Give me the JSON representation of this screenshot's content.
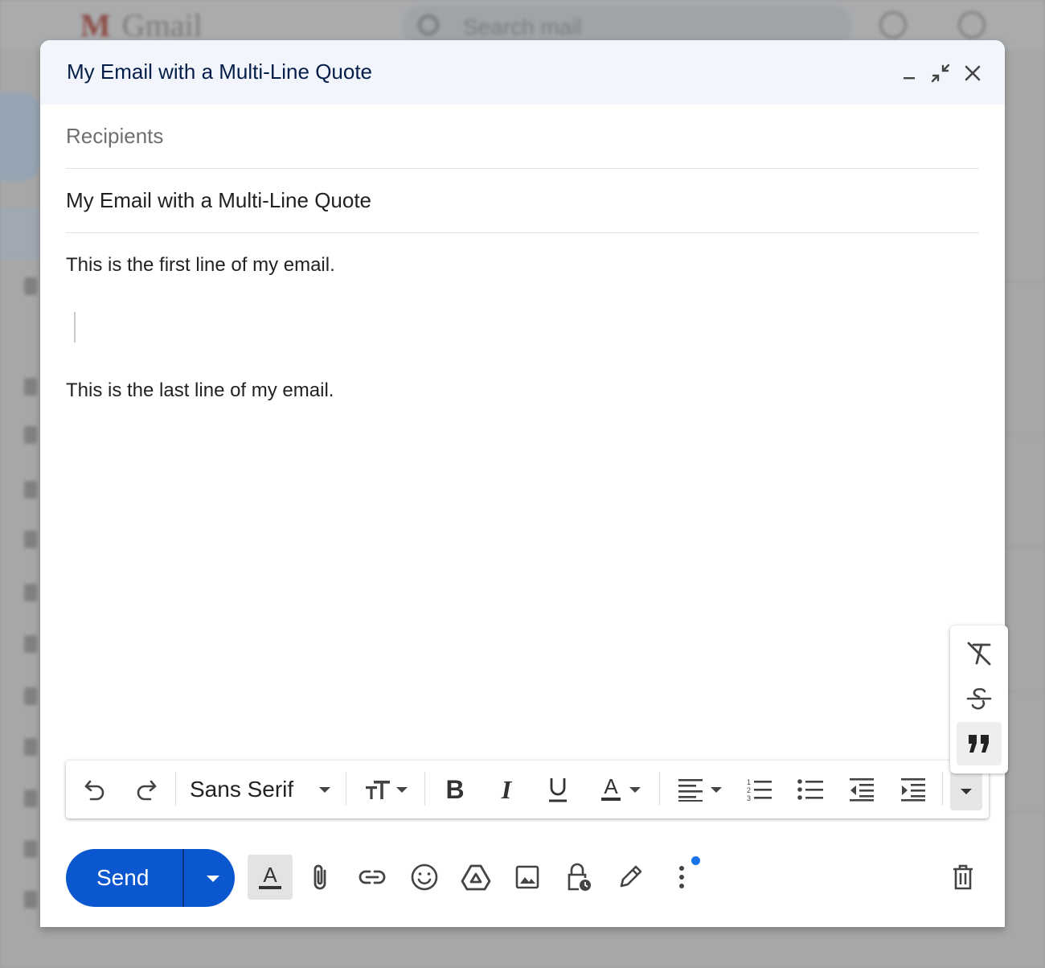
{
  "background": {
    "app_name": "Gmail",
    "search_placeholder": "Search mail"
  },
  "compose": {
    "title": "My Email with a Multi-Line Quote",
    "recipients_placeholder": "Recipients",
    "subject": "My Email with a Multi-Line Quote",
    "body_lines": {
      "first": "This is the first line of my email.",
      "last": "This is the last line of my email."
    }
  },
  "toolbar": {
    "font_family": "Sans Serif",
    "icons": [
      "undo-icon",
      "redo-icon",
      "font-size-icon",
      "bold-icon",
      "italic-icon",
      "underline-icon",
      "text-color-icon",
      "align-icon",
      "numbered-list-icon",
      "bulleted-list-icon",
      "indent-less-icon",
      "indent-more-icon",
      "more-formatting-icon"
    ]
  },
  "more_formatting_popup": {
    "icons": [
      "remove-formatting-icon",
      "strikethrough-icon",
      "quote-icon"
    ],
    "active": "quote-icon"
  },
  "bottom_bar": {
    "send_label": "Send",
    "icons": [
      "formatting-options-icon",
      "attach-icon",
      "link-icon",
      "emoji-icon",
      "drive-icon",
      "photo-icon",
      "confidential-mode-icon",
      "signature-icon",
      "more-options-icon",
      "discard-icon"
    ]
  },
  "colors": {
    "send_button": "#0b57d0",
    "title_bar": "#f2f6fc",
    "title_text": "#041e49",
    "notification_dot": "#1a73e8"
  }
}
